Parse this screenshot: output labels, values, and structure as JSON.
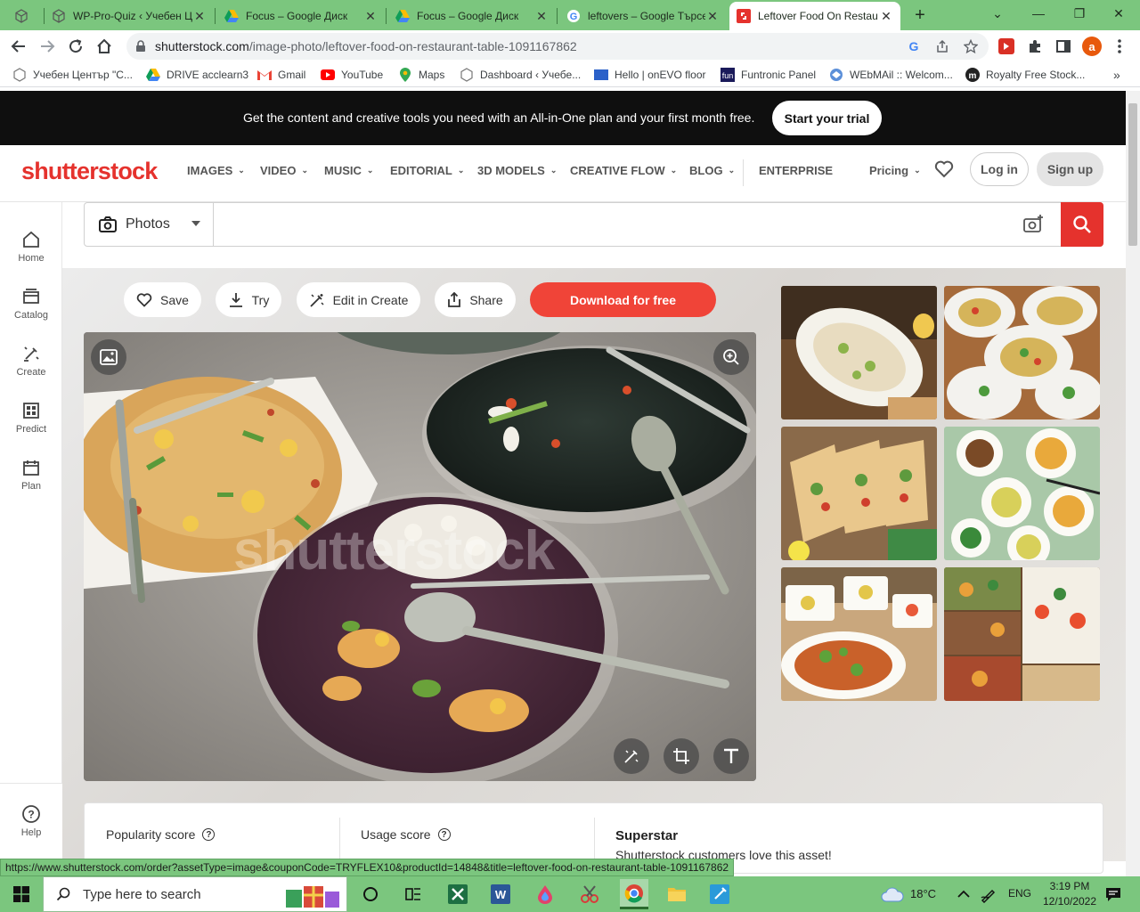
{
  "browser": {
    "tabs": [
      {
        "label": "",
        "icon": "cube-icon"
      },
      {
        "label": "WP-Pro-Quiz ‹ Учебен Ц",
        "icon": "cube-icon"
      },
      {
        "label": "Focus – Google Диск",
        "icon": "drive-icon"
      },
      {
        "label": "Focus – Google Диск",
        "icon": "drive-icon"
      },
      {
        "label": "leftovers – Google Търсе",
        "icon": "google-icon"
      },
      {
        "label": "Leftover Food On Restau",
        "icon": "shutterstock-icon"
      }
    ],
    "url_host": "shutterstock.com",
    "url_path": "/image-photo/leftover-food-on-restaurant-table-1091167862",
    "profile_initial": "a",
    "bookmarks": [
      {
        "label": "Учебен Център \"С...",
        "icon": "cube-icon"
      },
      {
        "label": "DRIVE acclearn3",
        "icon": "drive-icon"
      },
      {
        "label": "Gmail",
        "icon": "gmail-icon"
      },
      {
        "label": "YouTube",
        "icon": "youtube-icon"
      },
      {
        "label": "Maps",
        "icon": "maps-icon"
      },
      {
        "label": "Dashboard ‹ Учебе...",
        "icon": "cube-icon"
      },
      {
        "label": "Hello | onEVO floor",
        "icon": "onevo-icon"
      },
      {
        "label": "Funtronic Panel",
        "icon": "funtronic-icon"
      },
      {
        "label": "WEbMAil :: Welcom...",
        "icon": "webmail-icon"
      },
      {
        "label": "Royalty Free Stock...",
        "icon": "royalty-icon"
      }
    ]
  },
  "promo": {
    "text": "Get the content and creative tools you need with an All-in-One plan and your first month free.",
    "cta": "Start your trial"
  },
  "header": {
    "logo": "shutterstock",
    "nav": [
      "IMAGES",
      "VIDEO",
      "MUSIC",
      "EDITORIAL",
      "3D MODELS",
      "CREATIVE FLOW",
      "BLOG"
    ],
    "enterprise": "ENTERPRISE",
    "pricing": "Pricing",
    "login": "Log in",
    "signup": "Sign up"
  },
  "rail": [
    {
      "label": "Home",
      "icon": "home-icon"
    },
    {
      "label": "Catalog",
      "icon": "catalog-icon"
    },
    {
      "label": "Create",
      "icon": "create-icon"
    },
    {
      "label": "Predict",
      "icon": "predict-icon"
    },
    {
      "label": "Plan",
      "icon": "plan-icon"
    }
  ],
  "help_label": "Help",
  "search": {
    "type": "Photos",
    "value": "",
    "placeholder": ""
  },
  "actions": {
    "save": "Save",
    "try": "Try",
    "edit": "Edit in Create",
    "share": "Share",
    "download": "Download for free"
  },
  "photo": {
    "watermark": "shutterstock"
  },
  "stats": {
    "popularity": "Popularity score",
    "usage": "Usage score",
    "superstar_title": "Superstar",
    "superstar_text": "Shutterstock customers love this asset!"
  },
  "status_url": "https://www.shutterstock.com/order?assetType=image&couponCode=TRYFLEX10&productId=14848&title=leftover-food-on-restaurant-table-1091167862",
  "taskbar": {
    "search": "Type here to search",
    "temperature": "18°C",
    "lang": "ENG",
    "time": "3:19 PM",
    "date": "12/10/2022"
  },
  "colors": {
    "brand": "#e5322d",
    "download": "#f04438",
    "chrome_frame": "#7bc67e"
  }
}
